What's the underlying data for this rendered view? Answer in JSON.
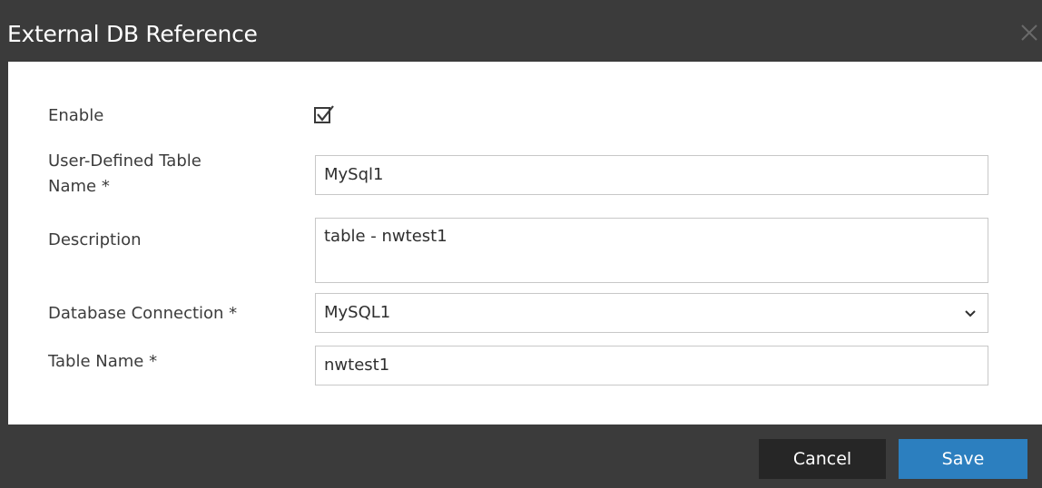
{
  "dialog": {
    "title": "External DB Reference",
    "close_icon": "close-icon"
  },
  "form": {
    "enable": {
      "label": "Enable",
      "checked": true
    },
    "table_display_name": {
      "label_line1": "User-Defined Table",
      "label_line2": "Name *",
      "value": "MySql1"
    },
    "description": {
      "label": "Description",
      "value": "table - nwtest1"
    },
    "database_connection": {
      "label": "Database Connection *",
      "value": "MySQL1"
    },
    "table_name": {
      "label": "Table Name *",
      "value": "nwtest1"
    }
  },
  "footer": {
    "cancel_label": "Cancel",
    "save_label": "Save"
  },
  "colors": {
    "dialog_background": "#3b3b3b",
    "cancel_button": "#262626",
    "save_button": "#2c7fbf"
  }
}
